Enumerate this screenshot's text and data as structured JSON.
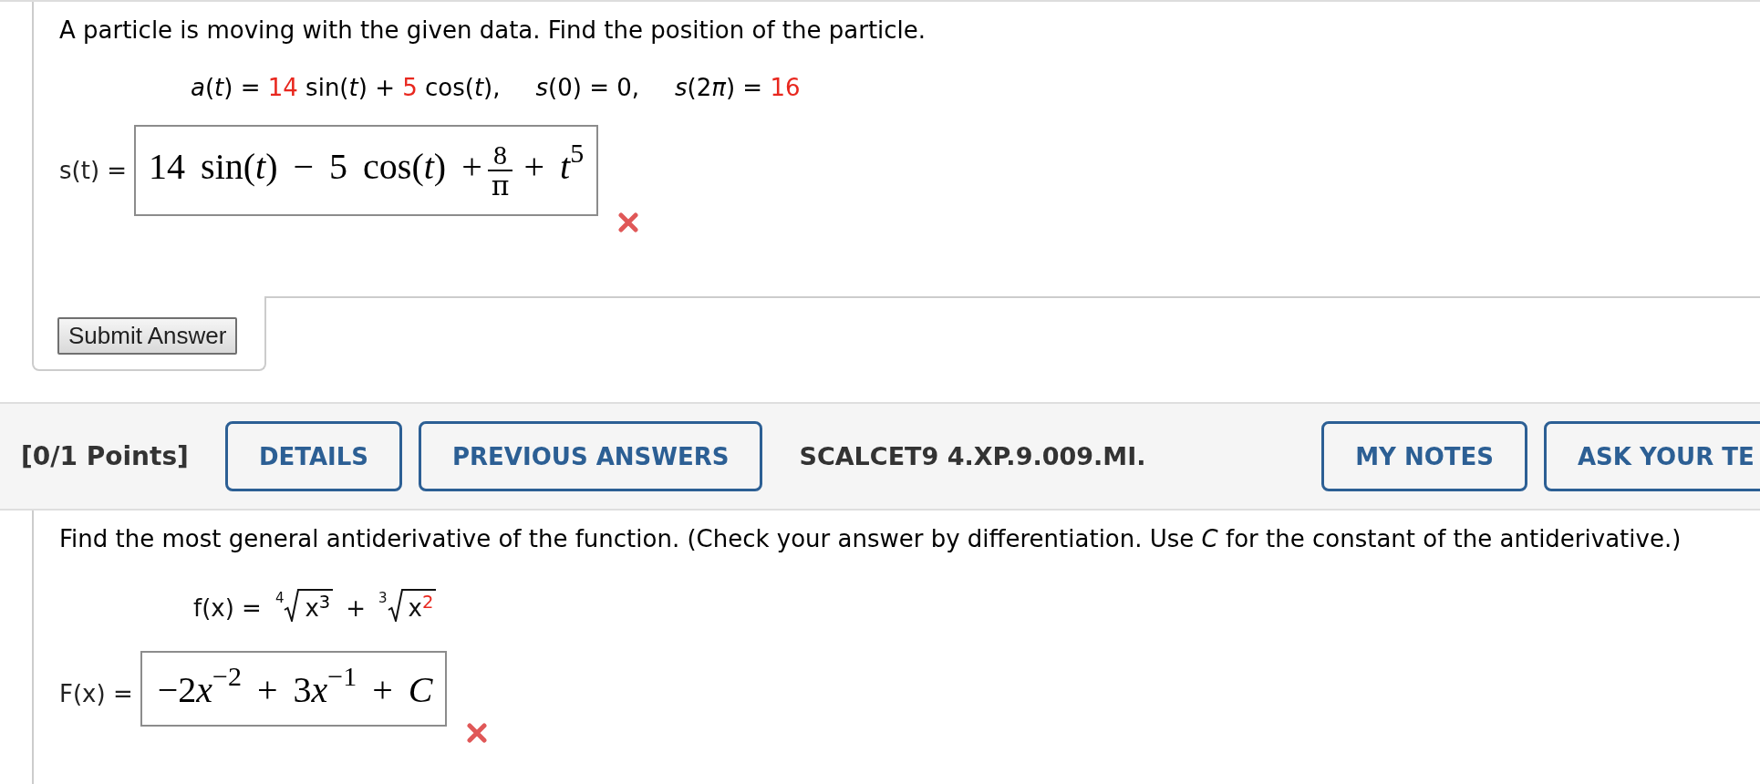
{
  "questions": [
    {
      "prompt": "A particle is moving with the given data. Find the position of the particle.",
      "given": [
        {
          "parts": [
            {
              "text": "*a*(*t*) = ",
              "color": "#000000"
            },
            {
              "text": "14",
              "color": "#e8271e"
            },
            {
              "text": " sin(*t*) + ",
              "color": "#000000"
            },
            {
              "text": "5",
              "color": "#e8271e"
            },
            {
              "text": " cos(*t*),",
              "color": "#000000"
            }
          ]
        },
        {
          "parts": [
            {
              "text": "*s*(0) = 0,",
              "color": "#000000"
            }
          ]
        },
        {
          "parts": [
            {
              "text": "*s*(2",
              "color": "#000000"
            },
            {
              "text": "*π*) = ",
              "color": "#000000"
            },
            {
              "text": "16",
              "color": "#e8271e"
            }
          ]
        }
      ],
      "answer": {
        "label": "s(t) =",
        "parts": [
          {
            "kind": "text",
            "text": "14 sin(*t*) − 5 cos(*t*) +"
          },
          {
            "kind": "fraction",
            "numerator": "8",
            "denominator": "π"
          },
          {
            "kind": "text",
            "text": "+ *t*$^{5}$"
          }
        ],
        "correct": false
      },
      "submit_button": "Submit Answer"
    },
    {
      "header": {
        "points": "[0/1 Points]",
        "buttons": [
          "DETAILS",
          "PREVIOUS ANSWERS"
        ],
        "code": "SCALCET9 4.XP.9.009.MI.",
        "right_buttons": [
          "MY NOTES",
          "ASK YOUR TE"
        ]
      },
      "prompt": "Find the most general antiderivative of the function. (Check your answer by differentiation. Use *C* for the constant of the antiderivative.)",
      "function": {
        "label": "f(x) =",
        "terms": [
          {
            "kind": "root",
            "index": "4",
            "base": "x",
            "power": "3",
            "color": "#000000"
          },
          {
            "kind": "operator",
            "text": "+"
          },
          {
            "kind": "root",
            "index": "3",
            "base": "x",
            "power": "2",
            "color": "#e8271e"
          }
        ]
      },
      "answer": {
        "label": "F(x) =",
        "parts": [
          {
            "kind": "text",
            "text": "−2"
          },
          {
            "kind": "text",
            "text": "*x*$^{−2}$ + 3"
          },
          {
            "kind": "text",
            "text": "*x*$^{−1}$ + *C*"
          }
        ],
        "correct": false
      }
    }
  ]
}
